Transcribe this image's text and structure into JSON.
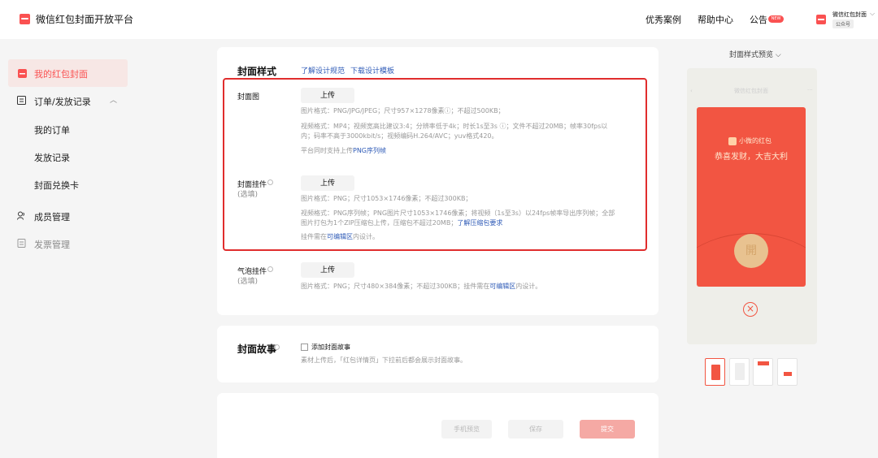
{
  "header": {
    "app_title": "微信红包封面开放平台",
    "nav": [
      "优秀案例",
      "帮助中心",
      "公告"
    ],
    "new_badge": "NEW",
    "account_name": "微信红包封面",
    "account_tag": "公众号"
  },
  "sidebar": {
    "my_covers": "我的红包封面",
    "orders_group": "订单/发放记录",
    "my_orders": "我的订单",
    "issue_records": "发放记录",
    "cover_cards": "封面兑换卡",
    "members": "成员管理",
    "invoices": "发票管理"
  },
  "cover_style": {
    "title": "封面样式",
    "design_spec_link": "了解设计规范",
    "template_link": "下载设计模板",
    "cover_image": {
      "label": "封面图",
      "upload": "上传",
      "img_format": "图片格式：PNG/JPG/JPEG；尺寸957×1278像素ⓘ；不超过500KB；",
      "video_format_1": "视频格式：MP4；视频宽高比建议3:4；分辨率低于4k；时长1s至3s ⓘ；文件不超过20MB；帧率30fps以",
      "video_format_2": "内；码率不高于3000kbit/s；视频编码H.264/AVC；yuv格式420。",
      "png_seq_prefix": "平台同时支持上传",
      "png_seq_link": "PNG序列帧"
    },
    "cover_pendant": {
      "label": "封面挂件",
      "optional": "(选填)",
      "upload": "上传",
      "img_format": "图片格式：PNG；尺寸1053×1746像素；不超过300KB；",
      "video_format_1": "视频格式：PNG序列帧；PNG图片尺寸1053×1746像素；将视频（1s至3s）以24fps帧率导出序列帧；全部",
      "video_format_2_prefix": "图片打包为1个ZIP压缩包上传，压缩包不超过20MB；",
      "video_format_2_link": "了解压缩包要求",
      "edit_prefix": "挂件需在",
      "edit_link": "可编辑区",
      "edit_suffix": "内设计。"
    },
    "bubble_pendant": {
      "label": "气泡挂件",
      "optional": "(选填)",
      "upload": "上传",
      "desc_prefix": "图片格式：PNG；尺寸480×384像素；不超过300KB；挂件需在",
      "desc_link": "可编辑区",
      "desc_suffix": "内设计。"
    }
  },
  "story": {
    "title": "封面故事",
    "checkbox_label": "添加封面故事",
    "desc": "素材上传后，「红包详情页」下拉前后都会展示封面故事。"
  },
  "actions": {
    "preview": "手机预览",
    "save": "保存",
    "submit": "提交"
  },
  "preview": {
    "toggle": "封面样式预览",
    "phone_header": "微信红包封面",
    "sender": "小微的红包",
    "wish": "恭喜发财，大吉大利",
    "open": "開"
  },
  "colors": {
    "brand_red": "#fa5151",
    "envelope_red": "#f25542",
    "link_blue": "#2f5bb7",
    "submit_pink": "#f5a9a4"
  }
}
